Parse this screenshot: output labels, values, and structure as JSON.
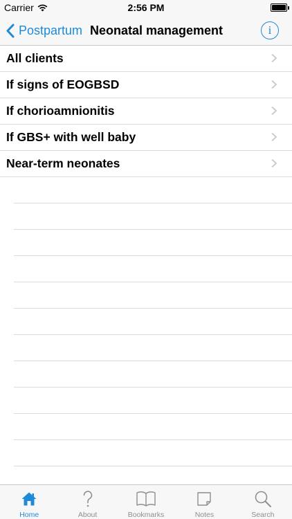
{
  "status_bar": {
    "carrier": "Carrier",
    "time": "2:56 PM"
  },
  "nav": {
    "back_label": "Postpartum",
    "title": "Neonatal management",
    "info_glyph": "i"
  },
  "list": {
    "items": [
      {
        "label": "All clients"
      },
      {
        "label": "If signs of EOGBSD"
      },
      {
        "label": "If chorioamnionitis"
      },
      {
        "label": "If GBS+ with well baby"
      },
      {
        "label": "Near-term neonates"
      }
    ]
  },
  "tabs": [
    {
      "label": "Home",
      "icon": "home-icon",
      "active": true
    },
    {
      "label": "About",
      "icon": "question-mark-icon",
      "active": false
    },
    {
      "label": "Bookmarks",
      "icon": "book-icon",
      "active": false
    },
    {
      "label": "Notes",
      "icon": "note-icon",
      "active": false
    },
    {
      "label": "Search",
      "icon": "search-icon",
      "active": false
    }
  ],
  "colors": {
    "accent": "#1f8ad6",
    "inactive": "#8e8e93",
    "separator": "#dcdce0",
    "bar_background": "#f7f7f8"
  }
}
